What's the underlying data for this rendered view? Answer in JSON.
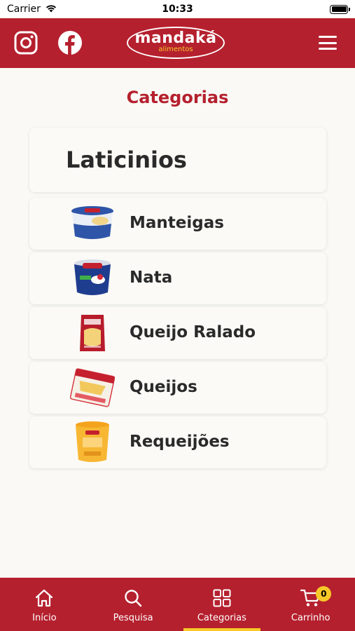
{
  "status_bar": {
    "carrier": "Carrier",
    "time": "10:33"
  },
  "header": {
    "logo_name": "mandaká",
    "logo_sub": "alimentos",
    "icons": [
      "instagram-icon",
      "facebook-icon",
      "menu-icon"
    ]
  },
  "page": {
    "title": "Categorias"
  },
  "category": {
    "name": "Laticinios",
    "items": [
      {
        "label": "Manteigas",
        "icon": "manteiga-product-image"
      },
      {
        "label": "Nata",
        "icon": "nata-product-image"
      },
      {
        "label": "Queijo Ralado",
        "icon": "queijo-ralado-product-image"
      },
      {
        "label": "Queijos",
        "icon": "queijos-product-image"
      },
      {
        "label": "Requeijões",
        "icon": "requeijao-product-image"
      }
    ]
  },
  "tabbar": {
    "tabs": [
      {
        "label": "Início",
        "icon": "home-icon"
      },
      {
        "label": "Pesquisa",
        "icon": "search-icon"
      },
      {
        "label": "Categorias",
        "icon": "grid-icon",
        "active": true
      },
      {
        "label": "Carrinho",
        "icon": "cart-icon"
      }
    ],
    "cart_count": "0"
  },
  "colors": {
    "brand_red": "#b5202e",
    "accent_yellow": "#f7c928",
    "background": "#faf9f5"
  }
}
